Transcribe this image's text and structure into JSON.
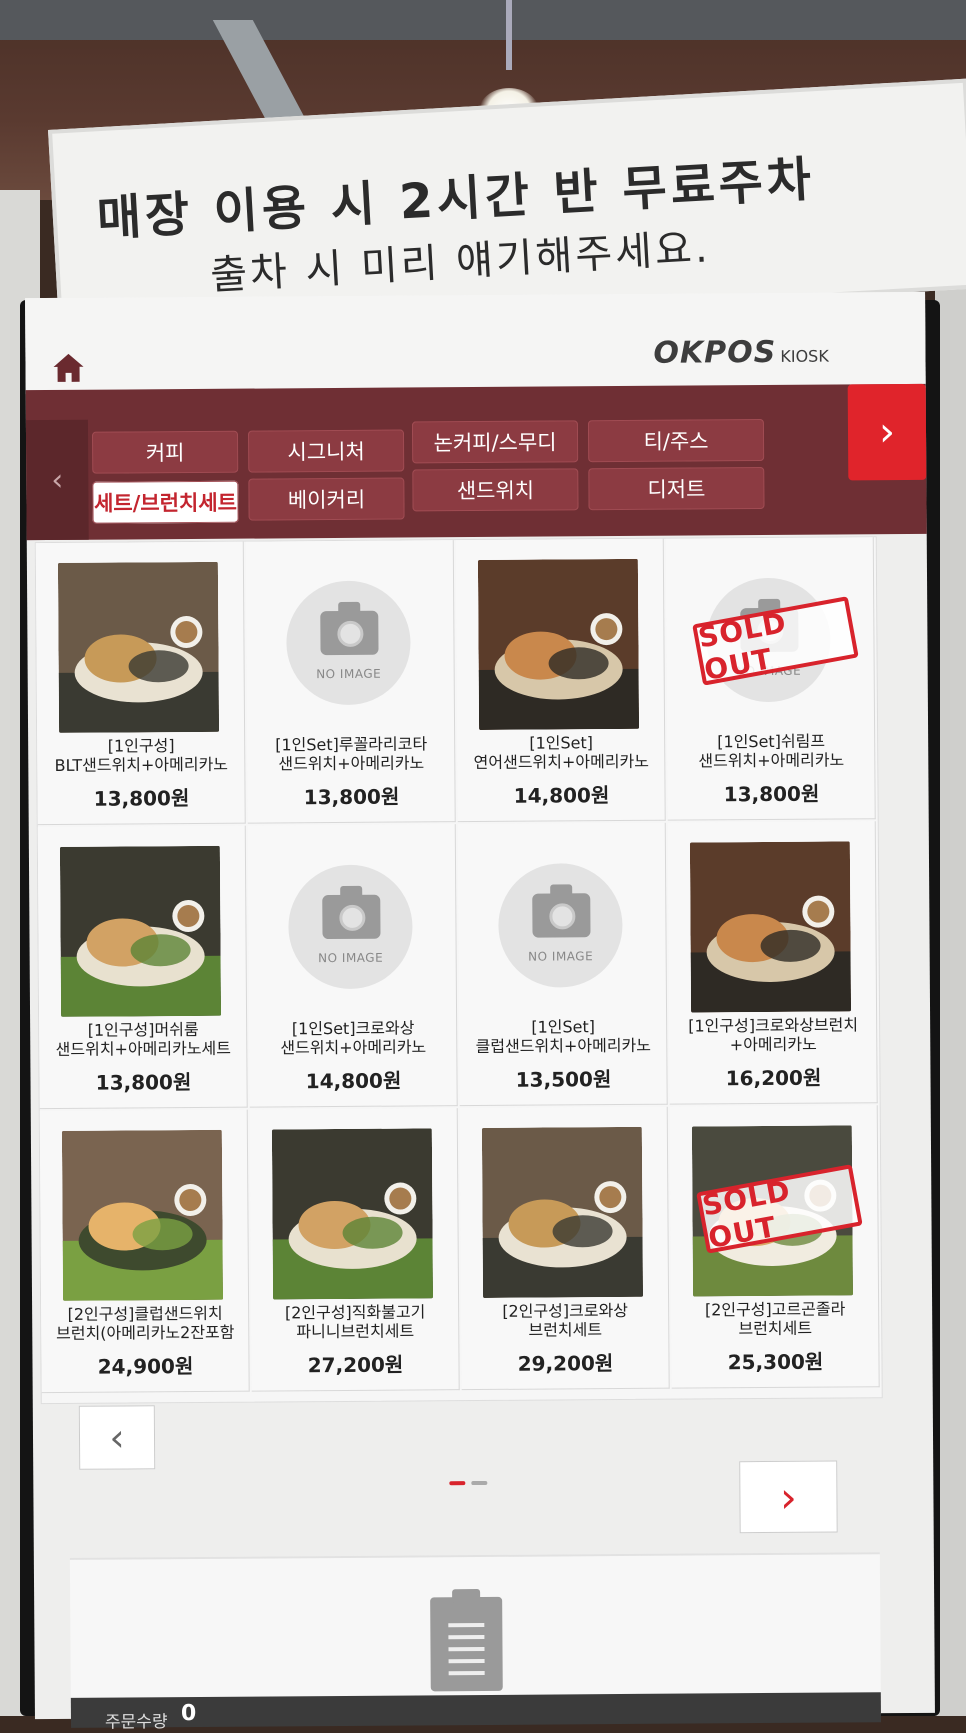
{
  "sign": {
    "line1": "매장 이용 시 2시간 반 무료주차",
    "line2": "출차 시 미리 얘기해주세요."
  },
  "header": {
    "brand": "OKPOS",
    "brand_sub": "KIOSK",
    "home_icon": "home-icon"
  },
  "categories": [
    {
      "label": "커피",
      "active": false
    },
    {
      "label": "시그니처",
      "active": false
    },
    {
      "label": "논커피/스무디",
      "active": false
    },
    {
      "label": "티/주스",
      "active": false
    },
    {
      "label": "세트/브런치세트",
      "active": true
    },
    {
      "label": "베이커리",
      "active": false
    },
    {
      "label": "샌드위치",
      "active": false
    },
    {
      "label": "디저트",
      "active": false
    }
  ],
  "no_image_text": "NO IMAGE",
  "sold_out_text": "SOLD OUT",
  "items": [
    {
      "name1": "[1인구성]",
      "name2": "BLT샌드위치+아메리카노",
      "price": "13,800원",
      "image": "photo",
      "sold_out": false
    },
    {
      "name1": "[1인Set]루꼴라리코타",
      "name2": "샌드위치+아메리카노",
      "price": "13,800원",
      "image": "none",
      "sold_out": false
    },
    {
      "name1": "[1인Set]",
      "name2": "연어샌드위치+아메리카노",
      "price": "14,800원",
      "image": "photo",
      "sold_out": false
    },
    {
      "name1": "[1인Set]쉬림프",
      "name2": "샌드위치+아메리카노",
      "price": "13,800원",
      "image": "none",
      "sold_out": true
    },
    {
      "name1": "[1인구성]머쉬룸",
      "name2": "샌드위치+아메리카노세트",
      "price": "13,800원",
      "image": "photo",
      "sold_out": false
    },
    {
      "name1": "[1인Set]크로와상",
      "name2": "샌드위치+아메리카노",
      "price": "14,800원",
      "image": "none",
      "sold_out": false
    },
    {
      "name1": "[1인Set]",
      "name2": "클럽샌드위치+아메리카노",
      "price": "13,500원",
      "image": "none",
      "sold_out": false
    },
    {
      "name1": "[1인구성]크로와상브런치",
      "name2": "+아메리카노",
      "price": "16,200원",
      "image": "photo",
      "sold_out": false
    },
    {
      "name1": "[2인구성]클럽샌드위치",
      "name2": "브런치(아메리카노2잔포함",
      "price": "24,900원",
      "image": "photo",
      "sold_out": false
    },
    {
      "name1": "[2인구성]직화불고기",
      "name2": "파니니브런치세트",
      "price": "27,200원",
      "image": "photo",
      "sold_out": false
    },
    {
      "name1": "[2인구성]크로와상",
      "name2": "브런치세트",
      "price": "29,200원",
      "image": "photo",
      "sold_out": false
    },
    {
      "name1": "[2인구성]고르곤졸라",
      "name2": "브런치세트",
      "price": "25,300원",
      "image": "photo",
      "sold_out": true
    }
  ],
  "pager": {
    "prev": "‹",
    "next": "›",
    "pages": 2,
    "current": 1
  },
  "order": {
    "qty_label": "주문수량",
    "qty_value": "0"
  },
  "colors": {
    "brand_red": "#d8232c",
    "category_bg": "#6f2f34",
    "category_btn": "#8c3b42"
  }
}
